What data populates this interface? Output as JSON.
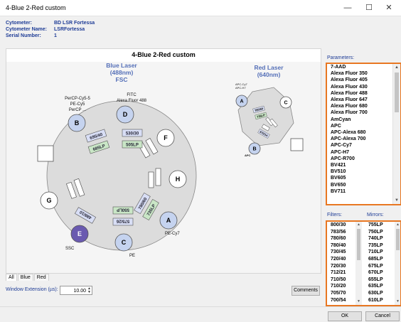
{
  "window": {
    "title": "4-Blue 2-Red custom",
    "minimize": "—",
    "maximize": "☐",
    "close": "✕"
  },
  "info": {
    "cytometer_label": "Cytometer:",
    "cytometer_value": "BD LSR Fortessa",
    "name_label": "Cytometer Name:",
    "name_value": "LSRFortessa",
    "serial_label": "Serial Number:",
    "serial_value": "1"
  },
  "work_title": "4-Blue 2-Red custom",
  "blue_laser": {
    "line1": "Blue Laser",
    "line2": "(488nm)",
    "line3": "FSC"
  },
  "red_laser": {
    "line1": "Red Laser",
    "line2": "(640nm)"
  },
  "blue_detectors": {
    "A": "A",
    "B": "B",
    "C": "C",
    "D": "D",
    "E": "E",
    "F": "F",
    "G": "G",
    "H": "H"
  },
  "blue_labels": {
    "B1": "PerCP-Cy5-5",
    "B2": "PE-Cy5",
    "B3": "PerCP ...",
    "D1": "FITC",
    "D2": "Alexa Fluor 488",
    "A": "PE-Cy7",
    "C": "PE",
    "E": "SSC"
  },
  "blue_filters": {
    "f695_40": "695/40",
    "f685LP": "685LP",
    "f530_30": "530/30",
    "f505LP": "505LP",
    "f780_60": "780/60",
    "f735LP": "735LP",
    "f550LP": "550LP",
    "f575_26": "575/26",
    "f488_10": "488/10"
  },
  "red_detectors": {
    "A": "A",
    "B": "B",
    "C": "C"
  },
  "red_labels": {
    "A1": "APC-Cy7",
    "A2": "APC-H7",
    "B": "APC"
  },
  "red_filters": {
    "r1": "780/60",
    "r2": "735LP",
    "r3": "670/14"
  },
  "tabs": [
    "All",
    "Blue",
    "Red"
  ],
  "window_extension": {
    "label": "Window Extension (µs):",
    "value": "10.00"
  },
  "buttons": {
    "comments": "Comments",
    "ok": "OK",
    "cancel": "Cancel"
  },
  "parameters_label": "Parameters:",
  "parameters": [
    "7-AAD",
    "Alexa Fluor 350",
    "Alexa Fluor 405",
    "Alexa Fluor 430",
    "Alexa Fluor 488",
    "Alexa Fluor 647",
    "Alexa Fluor 680",
    "Alexa Fluor 700",
    "AmCyan",
    "APC",
    "APC-Alexa 680",
    "APC-Alexa 700",
    "APC-Cy7",
    "APC-H7",
    "APC-R700",
    "BV421",
    "BV510",
    "BV605",
    "BV650",
    "BV711"
  ],
  "filters_label": "Filters:",
  "mirrors_label": "Mirrors:",
  "filters": [
    "800/30",
    "783/56",
    "780/60",
    "780/40",
    "730/45",
    "720/40",
    "720/30",
    "712/21",
    "710/50",
    "710/20",
    "705/70",
    "700/54"
  ],
  "mirrors": [
    "755LP",
    "750LP",
    "740LP",
    "735LP",
    "710LP",
    "685LP",
    "675LP",
    "670LP",
    "655LP",
    "635LP",
    "630LP",
    "610LP"
  ],
  "colors": {
    "accent_orange": "#e87722",
    "label_blue": "#1e3c96",
    "detector_fill": "#c5d3ef",
    "ssc_fill": "#6a5ab0",
    "filter_blue": "#d8def5",
    "filter_green": "#c9e6c6"
  }
}
